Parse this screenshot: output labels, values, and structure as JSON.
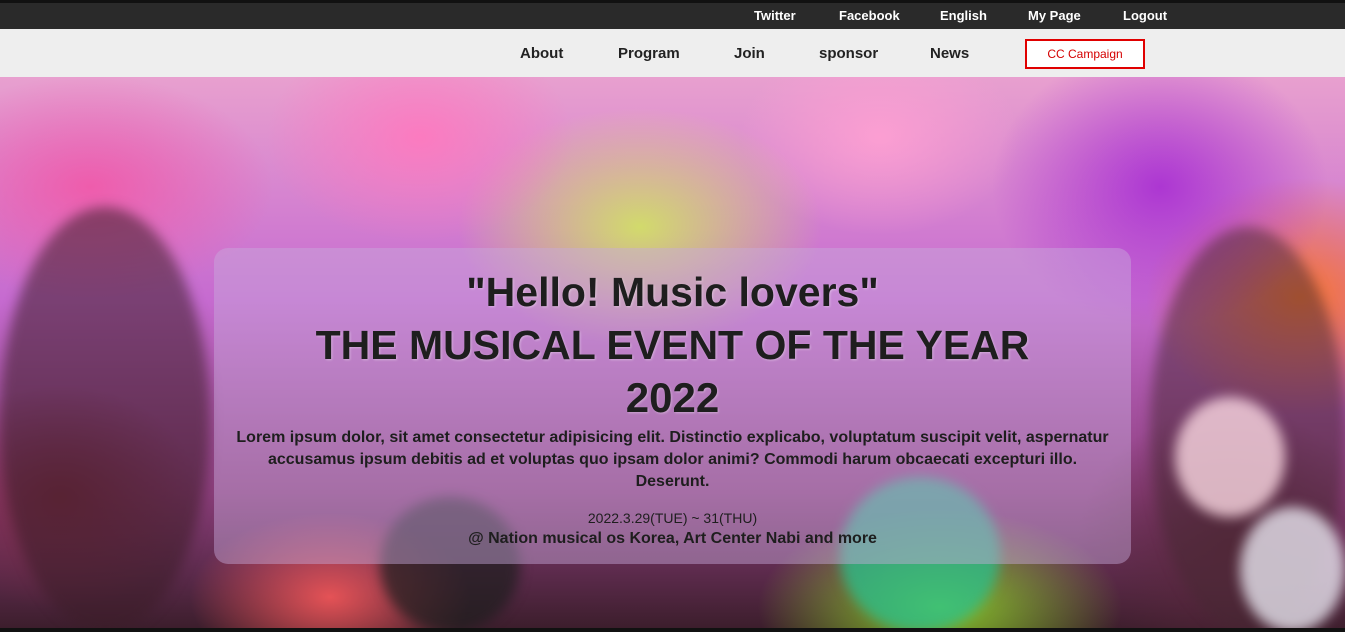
{
  "topbar": {
    "links": [
      "Twitter",
      "Facebook",
      "English",
      "My Page",
      "Logout"
    ]
  },
  "nav": {
    "items": [
      "About",
      "Program",
      "Join",
      "sponsor",
      "News"
    ],
    "campaign": "CC Campaign"
  },
  "hero": {
    "headline_1": "\"Hello! Music lovers\"",
    "headline_2": "THE MUSICAL EVENT OF THE YEAR",
    "headline_3": "2022",
    "description": "Lorem ipsum dolor, sit amet consectetur adipisicing elit. Distinctio explicabo, voluptatum suscipit velit, aspernatur accusamus ipsum debitis ad et voluptas quo ipsam dolor animi? Commodi harum obcaecati excepturi illo. Deserunt.",
    "date": "2022.3.29(TUE) ~ 31(THU)",
    "venue": "@ Nation musical os Korea, Art Center Nabi and more"
  },
  "colors": {
    "topbar_bg": "#2a2a2a",
    "campaign_border": "#e00000",
    "campaign_text": "#d40000"
  }
}
